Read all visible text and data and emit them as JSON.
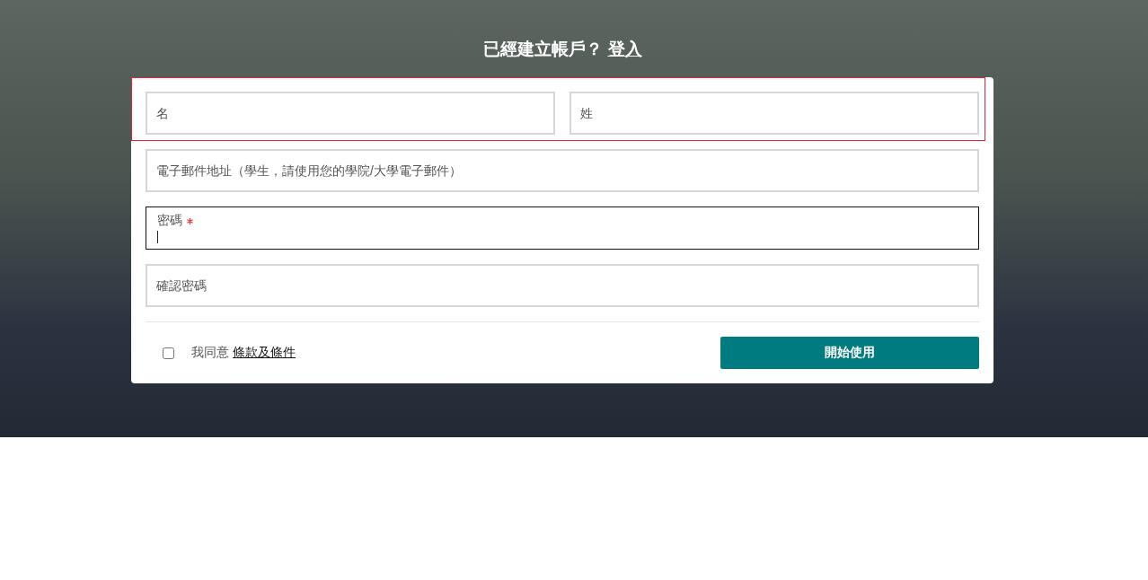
{
  "header": {
    "text": "已經建立帳戶？",
    "link": "登入"
  },
  "name_row": {
    "invalid": true,
    "fields": [
      {
        "placeholder": "名"
      },
      {
        "placeholder": "姓"
      }
    ]
  },
  "fields": [
    {
      "kind": "input",
      "placeholder": "電子郵件地址（學生，請使用您的學院/大學電子郵件）"
    },
    {
      "kind": "floating",
      "label": "密碼",
      "required": true,
      "focused": true
    },
    {
      "kind": "input",
      "placeholder": "確認密碼"
    }
  ],
  "terms": {
    "checked": false,
    "text": "我同意",
    "link": "條款及條件"
  },
  "submit": "開始使用"
}
